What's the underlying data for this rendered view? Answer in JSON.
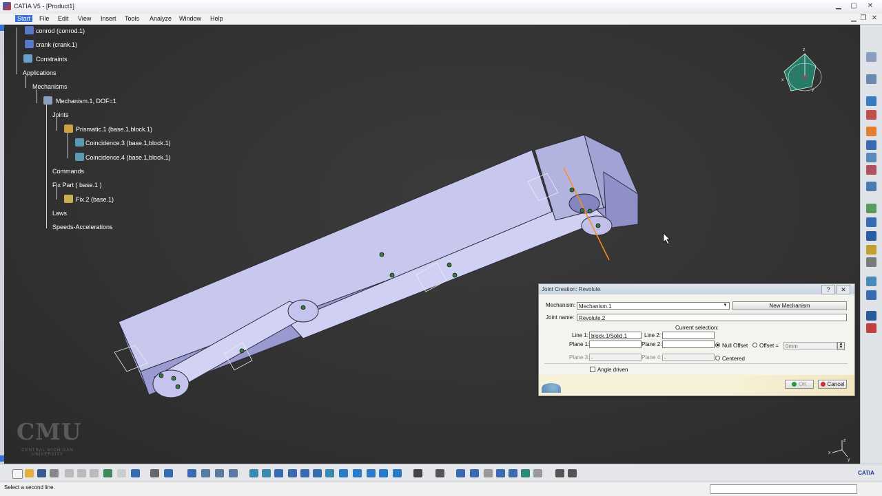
{
  "window": {
    "title": "CATIA V5 - [Product1]"
  },
  "menu": {
    "items": [
      "Start",
      "File",
      "Edit",
      "View",
      "Insert",
      "Tools",
      "Analyze",
      "Window",
      "Help"
    ]
  },
  "tree": [
    {
      "label": "conrod (conrod.1)"
    },
    {
      "label": "crank (crank.1)"
    },
    {
      "label": "Constraints"
    },
    {
      "label": "Applications"
    },
    {
      "label": "Mechanisms"
    },
    {
      "label": "Mechanism.1, DOF=1"
    },
    {
      "label": "Joints"
    },
    {
      "label": "Prismatic.1 (base.1,block.1)"
    },
    {
      "label": "Coincidence.3 (base.1,block.1)"
    },
    {
      "label": "Coincidence.4 (base.1,block.1)"
    },
    {
      "label": "Commands"
    },
    {
      "label": "Fix Part ( base.1 )"
    },
    {
      "label": "Fix.2 (base.1)"
    },
    {
      "label": "Laws"
    },
    {
      "label": "Speeds-Accelerations"
    }
  ],
  "dialog": {
    "title": "Joint Creation: Revolute",
    "help_label": "?",
    "close_label": "✕",
    "mechanism_label": "Mechanism:",
    "mechanism_value": "Mechanism.1",
    "new_mechanism_label": "New Mechanism",
    "joint_name_label": "Joint name:",
    "joint_name_value": "Revolute.2",
    "current_selection_label": "Current selection:",
    "line1_label": "Line 1:",
    "line1_value": "block.1/Solid.1",
    "line2_label": "Line 2:",
    "line2_value": "",
    "plane1_label": "Plane 1:",
    "plane1_value": "",
    "plane2_label": "Plane 2:",
    "plane2_value": "",
    "plane3_label": "Plane 3:",
    "plane3_value": "-",
    "plane4_label": "Plane 4:",
    "plane4_value": "-",
    "null_offset_label": "Null Offset",
    "offset_label": "Offset =",
    "offset_value": "0mm",
    "centered_label": "Centered",
    "angle_driven_label": "Angle driven",
    "ok_label": "OK",
    "cancel_label": "Cancel"
  },
  "watermark": {
    "logo": "CMU",
    "subtitle": "CENTRAL MICHIGAN UNIVERSITY"
  },
  "compass": {
    "x_label": "x",
    "y_label": "y",
    "z_label": "z"
  },
  "axis_triad": {
    "x_label": "x",
    "y_label": "y",
    "z_label": "z"
  },
  "status": {
    "message": "Select a second line."
  },
  "colors": {
    "part": "#b3b3e0",
    "selection": "#ff8a1f",
    "accent": "#3a6fd8",
    "compass": "#2a7a6a"
  }
}
